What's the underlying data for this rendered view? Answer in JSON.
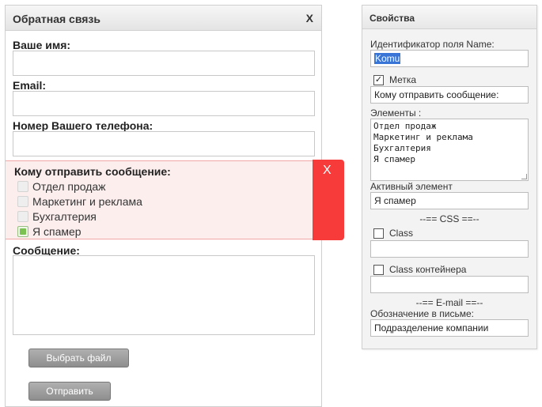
{
  "form": {
    "title": "Обратная связь",
    "close_label": "X",
    "name_label": "Ваше имя:",
    "email_label": "Email:",
    "phone_label": "Номер Вашего телефона:",
    "options_title": "Кому отправить сообщение:",
    "options": [
      {
        "label": "Отдел продаж",
        "checked": false
      },
      {
        "label": "Маркетинг и реклама",
        "checked": false
      },
      {
        "label": "Бухгалтерия",
        "checked": false
      },
      {
        "label": "Я спамер",
        "checked": true
      }
    ],
    "error_close_label": "X",
    "message_label": "Сообщение:",
    "choose_file_label": "Выбрать файл",
    "submit_label": "Отправить"
  },
  "props": {
    "title": "Свойства",
    "id_label": "Идентификатор поля Name:",
    "id_value": "Komu",
    "metka_label": "Метка",
    "metka_checked": true,
    "metka_value": "Кому отправить сообщение:",
    "elements_label": "Элементы :",
    "elements": [
      "Отдел продаж",
      "Маркетинг и реклама",
      "Бухгалтерия",
      "Я спамер"
    ],
    "active_label": "Активный элемент",
    "active_value": "Я спамер",
    "css_section": "--== CSS ==--",
    "class_label": "Class",
    "class_value": "",
    "container_class_label": "Class контейнера",
    "container_class_value": "",
    "email_section": "--== E-mail ==--",
    "letter_label": "Обозначение в письме:",
    "letter_value": "Подразделение компании"
  },
  "colors": {
    "error_red": "#f73a3a",
    "error_bg": "#fdeeee",
    "checked_green": "#7cc252",
    "selection_blue": "#3875d7"
  }
}
